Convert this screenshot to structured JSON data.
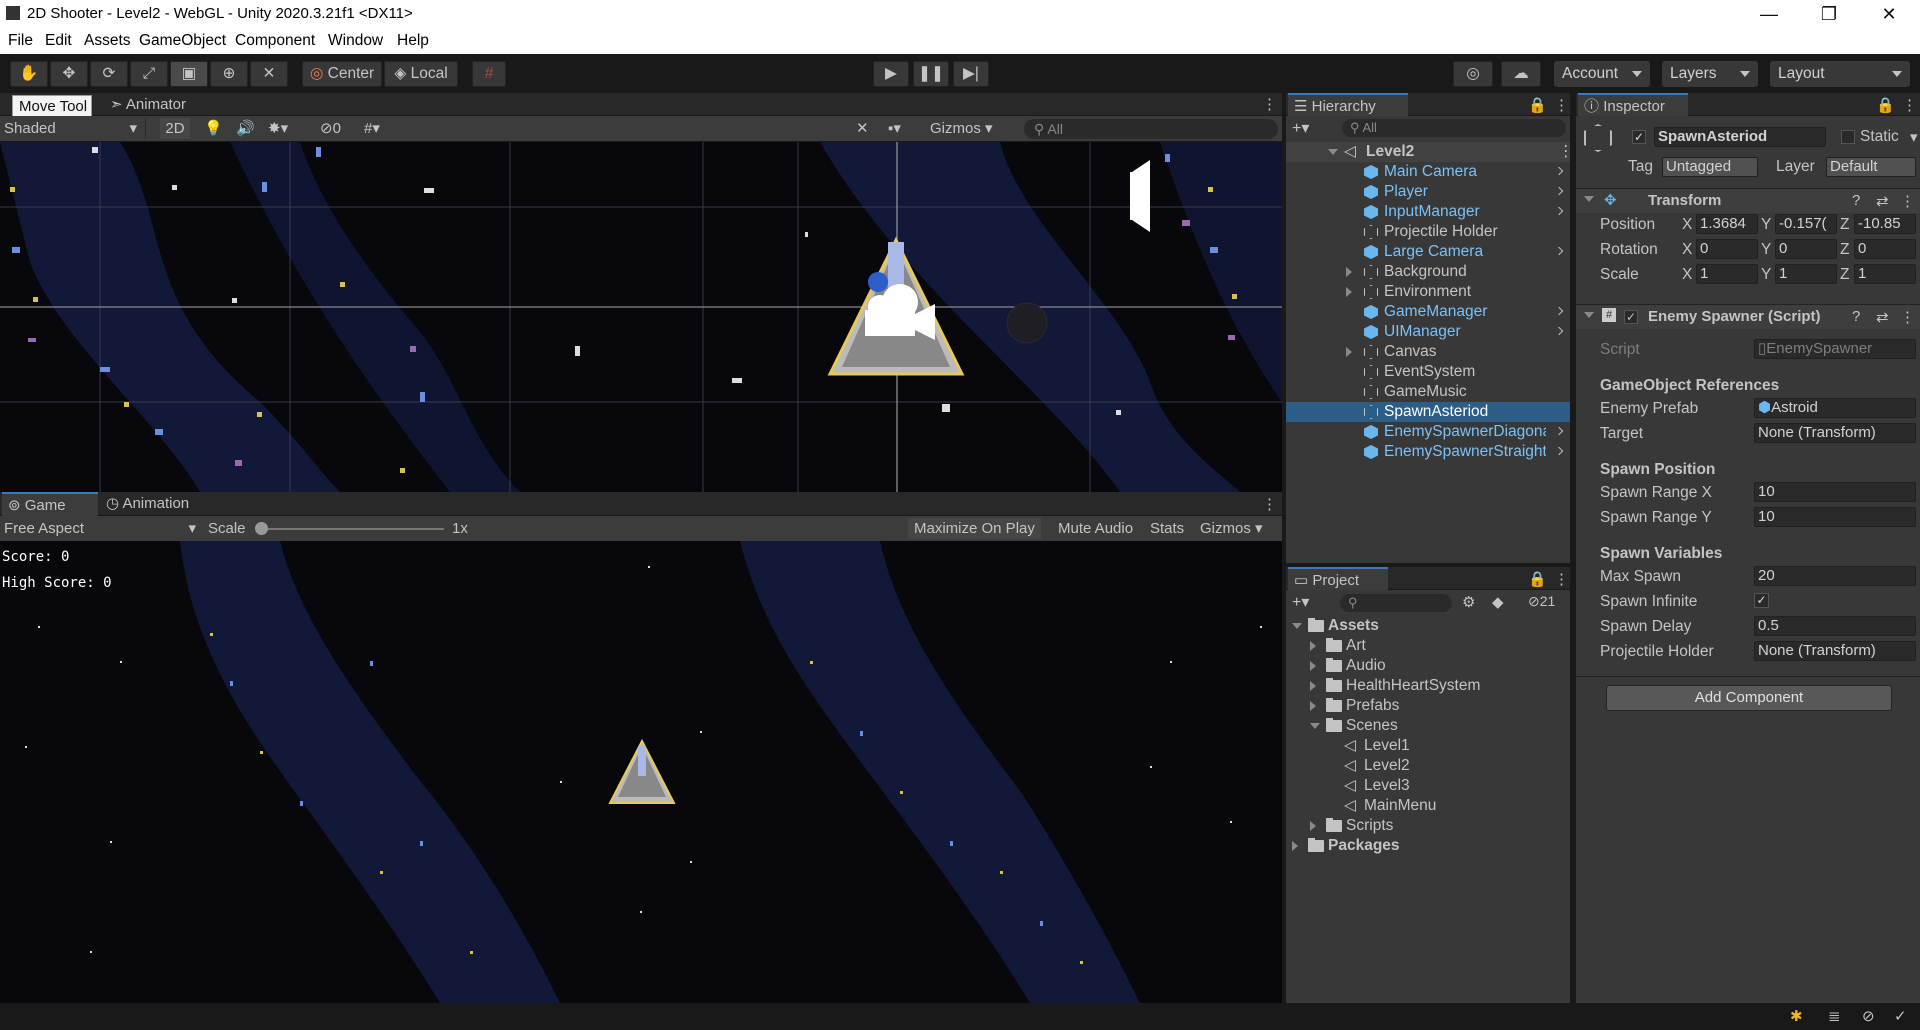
{
  "window": {
    "title": "2D Shooter - Level2 - WebGL - Unity 2020.3.21f1 <DX11>",
    "minimize": "—",
    "maximize": "❐",
    "close": "✕"
  },
  "menu": [
    "File",
    "Edit",
    "Assets",
    "GameObject",
    "Component",
    "Window",
    "Help"
  ],
  "toolbar": {
    "center": "Center",
    "local": "Local",
    "account": "Account",
    "layers": "Layers",
    "layout": "Layout"
  },
  "scene_panel": {
    "tooltip": "Move Tool",
    "animator_tab": "Animator",
    "shading": "Shaded",
    "mode_2d": "2D",
    "hidden_count": "0",
    "gizmos": "Gizmos",
    "search_placeholder": "All"
  },
  "game_panel": {
    "game_tab": "Game",
    "animation_tab": "Animation",
    "aspect": "Free Aspect",
    "scale_label": "Scale",
    "scale_value": "1x",
    "maximize_on_play": "Maximize On Play",
    "mute_audio": "Mute Audio",
    "stats": "Stats",
    "gizmos": "Gizmos",
    "hud_score": "Score: 0",
    "hud_high_score": "High Score: 0"
  },
  "hierarchy": {
    "tab": "Hierarchy",
    "search_placeholder": "All",
    "root": "Level2",
    "items": [
      {
        "label": "Main Camera",
        "type": "prefab",
        "arrow": true
      },
      {
        "label": "Player",
        "type": "prefab",
        "arrow": true
      },
      {
        "label": "InputManager",
        "type": "prefab",
        "arrow": true
      },
      {
        "label": "Projectile Holder",
        "type": "object",
        "arrow": false
      },
      {
        "label": "Large Camera",
        "type": "prefab",
        "arrow": true
      },
      {
        "label": "Background",
        "type": "object",
        "arrow": false,
        "fold": true
      },
      {
        "label": "Environment",
        "type": "object",
        "arrow": false,
        "fold": true
      },
      {
        "label": "GameManager",
        "type": "prefab",
        "arrow": true
      },
      {
        "label": "UIManager",
        "type": "prefab",
        "arrow": true
      },
      {
        "label": "Canvas",
        "type": "object",
        "arrow": false,
        "fold": true
      },
      {
        "label": "EventSystem",
        "type": "object",
        "arrow": false
      },
      {
        "label": "GameMusic",
        "type": "object",
        "arrow": false
      },
      {
        "label": "SpawnAsteriod",
        "type": "object",
        "arrow": false,
        "selected": true
      },
      {
        "label": "EnemySpawnerDiagona",
        "type": "prefab",
        "arrow": true
      },
      {
        "label": "EnemySpawnerStraight",
        "type": "prefab",
        "arrow": true
      }
    ]
  },
  "project": {
    "tab": "Project",
    "hidden_count": "21",
    "items": [
      {
        "label": "Assets",
        "level": 0,
        "open": true,
        "bold": true
      },
      {
        "label": "Art",
        "level": 1
      },
      {
        "label": "Audio",
        "level": 1
      },
      {
        "label": "HealthHeartSystem",
        "level": 1
      },
      {
        "label": "Prefabs",
        "level": 1
      },
      {
        "label": "Scenes",
        "level": 1,
        "open": true
      },
      {
        "label": "Level1",
        "level": 2,
        "scene": true
      },
      {
        "label": "Level2",
        "level": 2,
        "scene": true
      },
      {
        "label": "Level3",
        "level": 2,
        "scene": true
      },
      {
        "label": "MainMenu",
        "level": 2,
        "scene": true
      },
      {
        "label": "Scripts",
        "level": 1
      },
      {
        "label": "Packages",
        "level": 0,
        "bold": true
      }
    ]
  },
  "inspector": {
    "tab": "Inspector",
    "object_name": "SpawnAsteriod",
    "static": "Static",
    "tag_label": "Tag",
    "tag": "Untagged",
    "layer_label": "Layer",
    "layer": "Default",
    "transform": {
      "title": "Transform",
      "position_label": "Position",
      "rotation_label": "Rotation",
      "scale_label": "Scale",
      "x": "X",
      "y": "Y",
      "z": "Z",
      "position": [
        "1.3684",
        "-0.157(",
        "-10.85"
      ],
      "rotation": [
        "0",
        "0",
        "0"
      ],
      "scale": [
        "1",
        "1",
        "1"
      ]
    },
    "spawner": {
      "title": "Enemy Spawner (Script)",
      "script_label": "Script",
      "script": "EnemySpawner",
      "refs_header": "GameObject References",
      "enemy_prefab_label": "Enemy Prefab",
      "enemy_prefab": "Astroid",
      "target_label": "Target",
      "target": "None (Transform)",
      "pos_header": "Spawn Position",
      "range_x_label": "Spawn Range X",
      "range_x": "10",
      "range_y_label": "Spawn Range Y",
      "range_y": "10",
      "vars_header": "Spawn Variables",
      "max_spawn_label": "Max Spawn",
      "max_spawn": "20",
      "infinite_label": "Spawn Infinite",
      "infinite": "✓",
      "delay_label": "Spawn Delay",
      "delay": "0.5",
      "holder_label": "Projectile Holder",
      "holder": "None (Transform)"
    },
    "add_component": "Add Component"
  },
  "colors": {
    "selection": "#2c5d87",
    "prefab_text": "#7bc1f5",
    "accent": "#3a79bb"
  }
}
